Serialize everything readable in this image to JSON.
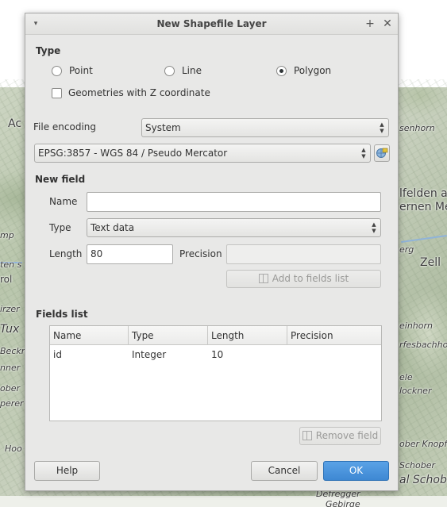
{
  "dialog": {
    "title": "New Shapefile Layer",
    "type_section": "Type",
    "geometry_options": [
      "Point",
      "Line",
      "Polygon"
    ],
    "selected_geometry": "Polygon",
    "z_coordinate_label": "Geometries with Z coordinate",
    "file_encoding_label": "File encoding",
    "file_encoding_value": "System",
    "crs_value": "EPSG:3857 - WGS 84 / Pseudo Mercator",
    "new_field_section": "New field",
    "name_label": "Name",
    "name_value": "",
    "field_type_label": "Type",
    "field_type_value": "Text data",
    "length_label": "Length",
    "length_value": "80",
    "precision_label": "Precision",
    "precision_value": "",
    "add_to_fields_label": "Add to fields list",
    "fields_list_section": "Fields list",
    "table": {
      "columns": [
        "Name",
        "Type",
        "Length",
        "Precision"
      ],
      "rows": [
        {
          "name": "id",
          "type": "Integer",
          "length": "10",
          "precision": ""
        }
      ]
    },
    "remove_field_label": "Remove field",
    "help_label": "Help",
    "cancel_label": "Cancel",
    "ok_label": "OK"
  },
  "map_labels": {
    "ac": "Ac",
    "senhorn": "senhorn",
    "lfelden": "lfelden a",
    "ernen": "ernen Me",
    "mp": "mp",
    "erg": "erg",
    "zell": "Zell",
    "ten": "ten s",
    "rol": "rol",
    "irzer": "irzer",
    "tux": "Tux",
    "einhorn": "einhorn",
    "rfesbach": "rfesbachho",
    "beckn": "Beckn",
    "nner": "nner",
    "ele": "ele",
    "lockner": "lockner",
    "ober": "ober",
    "perer": "perer",
    "ober_knopf": "ober Knopf",
    "hoo": "Hoo",
    "schober": "Schober",
    "al_schob": "al Schob",
    "defregger": "Defregger",
    "gebirge": "Gebirge"
  },
  "colors": {
    "ok_button": "#3e88d3",
    "dialog_bg": "#e8e8e7",
    "map_bg": "#c9d2c2"
  }
}
